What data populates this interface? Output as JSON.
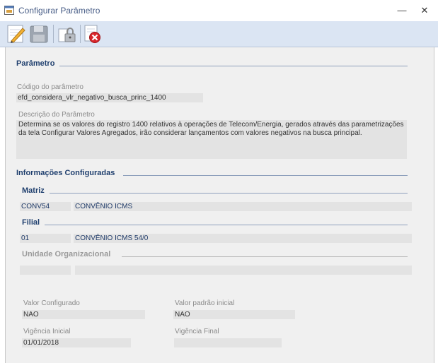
{
  "window": {
    "title": "Configurar Parâmetro",
    "minimize_glyph": "—",
    "close_glyph": "✕"
  },
  "toolbar": {
    "icons": [
      "edit-icon",
      "save-icon",
      "lock-icon",
      "delete-icon"
    ]
  },
  "parametro": {
    "section_title": "Parâmetro",
    "codigo_label": "Código do parâmetro",
    "codigo_value": "efd_considera_vlr_negativo_busca_princ_1400",
    "descricao_label": "Descrição do Parâmetro",
    "descricao_value": "Determina se os valores do registro 1400 relativos à operações de Telecom/Energia, gerados através das parametrizações da tela Configurar Valores Agregados, irão considerar lançamentos com valores negativos na busca principal."
  },
  "informacoes": {
    "section_title": "Informações Configuradas",
    "matriz": {
      "title": "Matriz",
      "code": "CONV54",
      "description": "CONVÊNIO ICMS"
    },
    "filial": {
      "title": "Filial",
      "code": "01",
      "description": "CONVÊNIO ICMS 54/0"
    },
    "unidade": {
      "title": "Unidade Organizacional",
      "code": "",
      "description": ""
    }
  },
  "valores": {
    "valor_configurado_label": "Valor Configurado",
    "valor_configurado": "NAO",
    "valor_padrao_label": "Valor padrão inicial",
    "valor_padrao": "NAO",
    "vigencia_inicial_label": "Vigência Inicial",
    "vigencia_inicial": "01/01/2018",
    "vigencia_final_label": "Vigência Final",
    "vigencia_final": ""
  },
  "colors": {
    "toolbar_bg": "#dbe5f3",
    "section_text": "#1f3f6e",
    "field_bg": "#e3e3e3",
    "content_bg": "#f0f0f0"
  }
}
